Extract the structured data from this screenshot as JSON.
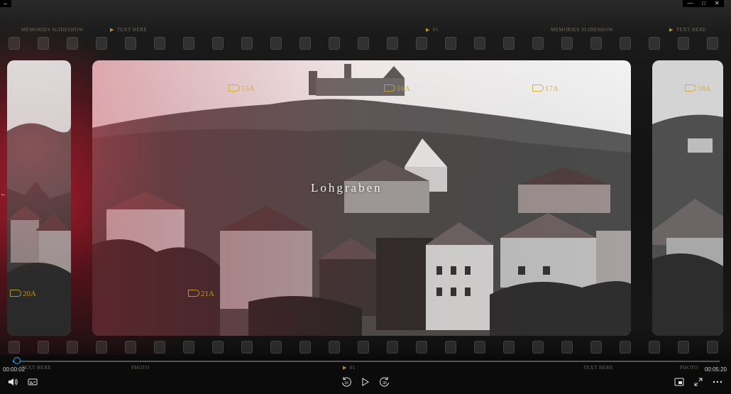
{
  "strip": {
    "top_labels": [
      "MEMORIES SLIDESHOW",
      "TEXT HERE",
      "01",
      "MEMORIES SLIDESHOW",
      "TEXT HERE"
    ],
    "bottom_labels": [
      "TEXT HERE",
      "PHOTO",
      "01",
      "TEXT HERE",
      "PHOTO"
    ]
  },
  "frames": {
    "main_title": "Lohgraben",
    "codes": [
      "15A",
      "16A",
      "17A",
      "18A",
      "20A",
      "21A"
    ]
  },
  "player": {
    "time_current": "00:00:02",
    "time_total": "00:05:20",
    "progress": 0.006,
    "skip_back_label": "10",
    "skip_forward_label": "30"
  },
  "window": {
    "minimize_icon": "minimize-icon",
    "maximize_icon": "maximize-icon",
    "close_icon": "close-icon"
  }
}
